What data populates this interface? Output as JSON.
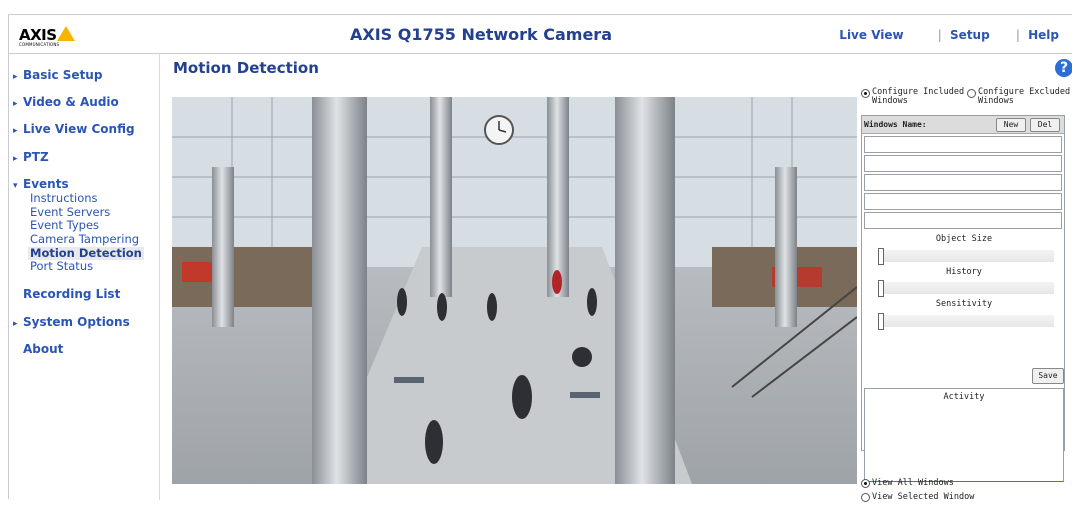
{
  "header": {
    "logo_word": "AXIS",
    "logo_sub": "COMMUNICATIONS",
    "title": "AXIS Q1755 Network Camera",
    "nav": [
      {
        "label": "Live View"
      },
      {
        "label": "Setup"
      },
      {
        "label": "Help"
      }
    ],
    "separator": "|"
  },
  "sidebar": {
    "items": [
      {
        "label": "Basic Setup",
        "arrow": "▸"
      },
      {
        "label": "Video & Audio",
        "arrow": "▸"
      },
      {
        "label": "Live View Config",
        "arrow": "▸"
      },
      {
        "label": "PTZ",
        "arrow": "▸"
      },
      {
        "label": "Events",
        "arrow": "▾"
      },
      {
        "label": "Recording List",
        "arrow": ""
      },
      {
        "label": "System Options",
        "arrow": "▸"
      },
      {
        "label": "About",
        "arrow": ""
      }
    ],
    "events_sub": [
      {
        "label": "Instructions"
      },
      {
        "label": "Event Servers"
      },
      {
        "label": "Event Types"
      },
      {
        "label": "Camera Tampering"
      },
      {
        "label": "Motion Detection"
      },
      {
        "label": "Port Status"
      }
    ]
  },
  "main": {
    "page_title": "Motion Detection",
    "help_icon": "?"
  },
  "panel": {
    "configure_included_1": "Configure Included",
    "configure_included_2": "Windows",
    "configure_excluded_1": "Configure Excluded",
    "configure_excluded_2": "Windows",
    "selected_configure": "included",
    "windows_name_label": "Windows Name:",
    "new_label": "New",
    "del_label": "Del",
    "object_size_label": "Object Size",
    "history_label": "History",
    "sensitivity_label": "Sensitivity",
    "object_size_level": 0,
    "history_level": 0,
    "sensitivity_level": 0,
    "save_label": "Save",
    "activity_label": "Activity",
    "view_all_label": "View All Windows",
    "view_selected_label": "View Selected Window",
    "selected_view": "all"
  },
  "colors": {
    "accent": "#2b55b4",
    "title": "#23418e",
    "logo_triangle": "#f4b400"
  }
}
